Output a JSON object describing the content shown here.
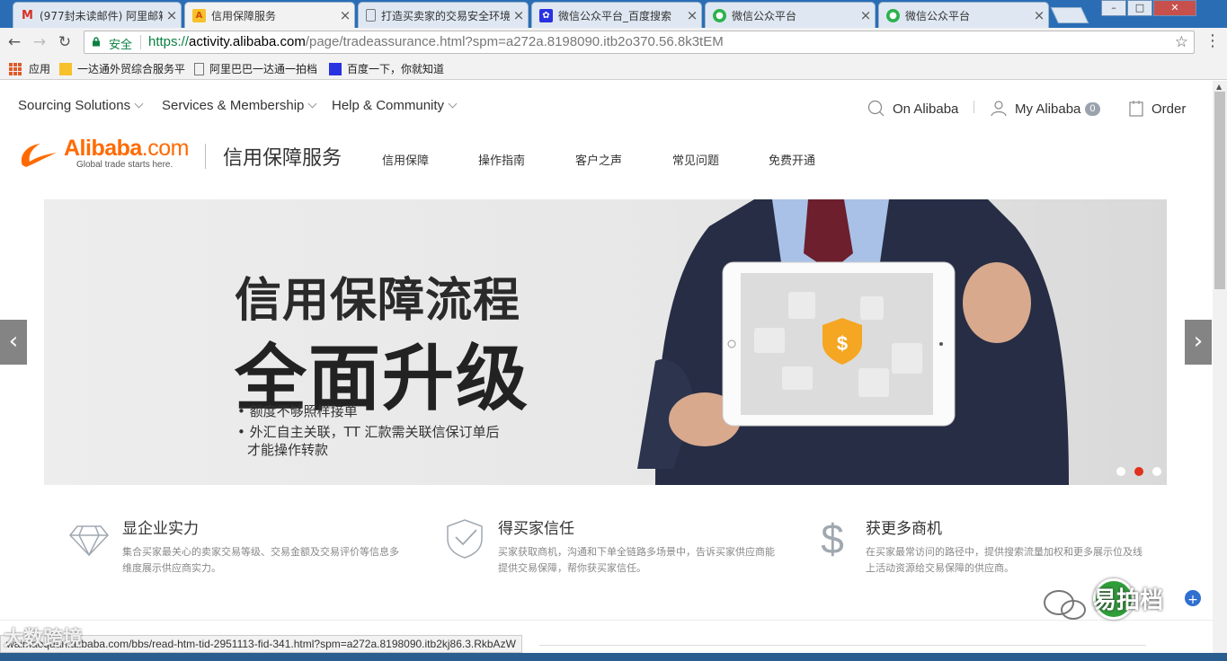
{
  "tabs": [
    {
      "title": "(977封未读邮件) 阿里邮箱",
      "favicon": "gmail-icon"
    },
    {
      "title": "信用保障服务",
      "favicon": "alibaba-icon",
      "active": true
    },
    {
      "title": "打造买卖家的交易安全环境",
      "favicon": "page-icon"
    },
    {
      "title": "微信公众平台_百度搜索",
      "favicon": "baidu-icon"
    },
    {
      "title": "微信公众平台",
      "favicon": "wechat-icon"
    },
    {
      "title": "微信公众平台",
      "favicon": "wechat-icon"
    }
  ],
  "window": {
    "minimize": "–",
    "maximize": "□",
    "close": "✕"
  },
  "address": {
    "secure_label": "安全",
    "scheme": "https://",
    "host": "activity.alibaba.com",
    "path": "/page/tradeassurance.html?spm=a272a.8198090.itb2o370.56.8k3tEM"
  },
  "bookmarks": [
    {
      "label": "应用",
      "icon": "apps-icon"
    },
    {
      "label": "一达通外贸综合服务平",
      "icon": "yidatong-icon"
    },
    {
      "label": "阿里巴巴一达通一拍档",
      "icon": "page-icon"
    },
    {
      "label": "百度一下，你就知道",
      "icon": "baidu-icon"
    }
  ],
  "topnav": {
    "sourcing": "Sourcing Solutions",
    "services": "Services & Membership",
    "help": "Help & Community",
    "on_alibaba": "On Alibaba",
    "my_alibaba": "My Alibaba",
    "my_alibaba_badge": "0",
    "order": "Order"
  },
  "brand": {
    "logo_main": "Alibaba",
    "logo_com": ".com",
    "logo_tagline": "Global trade starts here.",
    "title": "信用保障服务",
    "nav": [
      "信用保障",
      "操作指南",
      "客户之声",
      "常见问题",
      "免费开通"
    ]
  },
  "banner": {
    "heading1": "信用保障流程",
    "heading2": "全面升级",
    "bullets": [
      "额度不够照样接单",
      "外汇自主关联，TT 汇款需关联信保订单后",
      "才能操作转款"
    ],
    "active_slide": 2,
    "slide_count": 3,
    "prev": "‹",
    "next": "›"
  },
  "features": [
    {
      "icon": "diamond-icon",
      "title": "显企业实力",
      "desc": "集合买家最关心的卖家交易等级、交易金额及交易评价等信息多维度展示供应商实力。"
    },
    {
      "icon": "shield-check-icon",
      "title": "得买家信任",
      "desc": "买家获取商机，沟通和下单全链路多场景中，告诉买家供应商能提供交易保障，帮你获买家信任。"
    },
    {
      "icon": "dollar-icon",
      "title": "获更多商机",
      "desc": "在买家最常访问的路径中，提供搜索流量加权和更多展示位及线上活动资源给交易保障的供应商。"
    }
  ],
  "statusbar": {
    "url": "waimaoquan.alibaba.com/bbs/read-htm-tid-2951113-fid-341.html?spm=a272a.8198090.itb2kj86.3.RkbAzW"
  },
  "watermark": {
    "left": "大数跨境",
    "right": "易拍档"
  },
  "colors": {
    "accent": "#ff6a00",
    "active_dot": "#e0301e",
    "secure": "#0b8043",
    "tabbar": "#2a6db5"
  }
}
